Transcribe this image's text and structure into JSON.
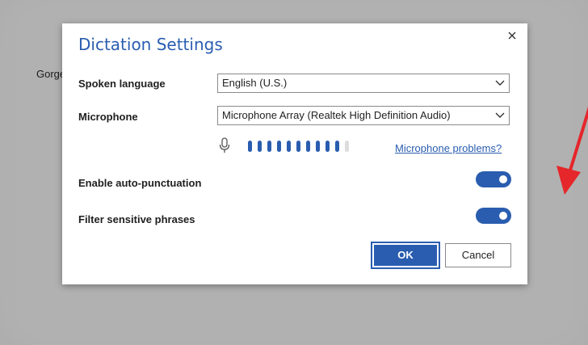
{
  "background": {
    "text": "Gorge"
  },
  "dialog": {
    "title": "Dictation Settings",
    "close_icon": "close-icon",
    "spoken_language": {
      "label": "Spoken language",
      "value": "English (U.S.)"
    },
    "microphone": {
      "label": "Microphone",
      "value": "Microphone Array (Realtek High Definition Audio)"
    },
    "mic_level": {
      "active_bars": 10,
      "total_bars": 11
    },
    "microphone_problems_link": "Microphone problems?",
    "auto_punctuation": {
      "label": "Enable auto-punctuation",
      "enabled": true
    },
    "filter_sensitive": {
      "label": "Filter sensitive phrases",
      "enabled": true
    },
    "ok_label": "OK",
    "cancel_label": "Cancel"
  },
  "colors": {
    "accent": "#2a5db0",
    "arrow": "#e5262a",
    "overlay": "#ababab"
  }
}
